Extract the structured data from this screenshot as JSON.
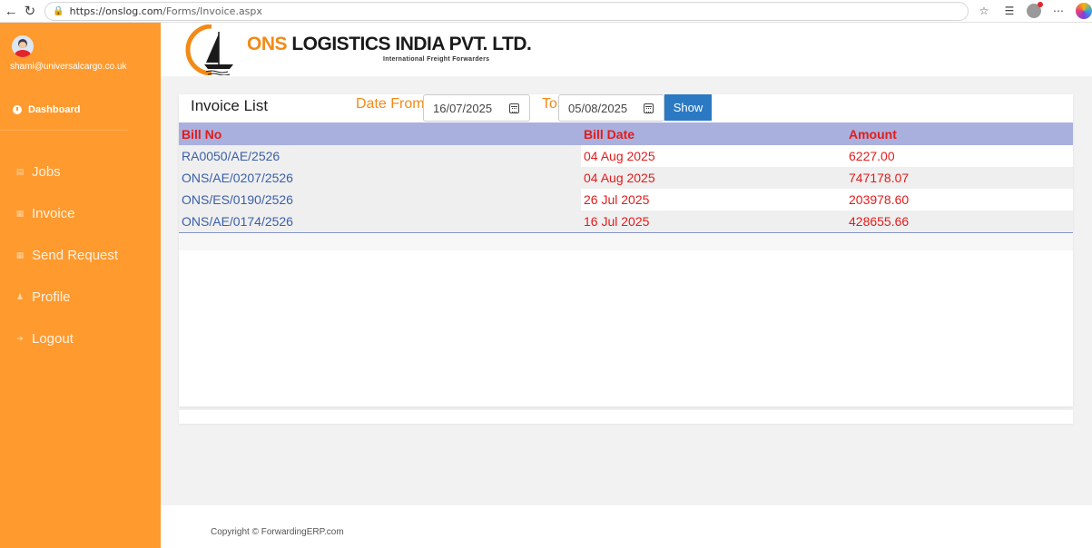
{
  "browser": {
    "url_host": "https://onslog.com",
    "url_path": "/Forms/Invoice.aspx"
  },
  "sidebar": {
    "user_email": "shami@universalcargo.co.uk",
    "dashboard_label": "Dashboard",
    "items": [
      {
        "label": "Jobs",
        "icon": "chart-icon"
      },
      {
        "label": "Invoice",
        "icon": "table-icon"
      },
      {
        "label": "Send Request",
        "icon": "table-icon"
      },
      {
        "label": "Profile",
        "icon": "user-icon"
      },
      {
        "label": "Logout",
        "icon": "logout-icon"
      }
    ]
  },
  "header": {
    "brand_ons": "ONS",
    "brand_rest": " LOGISTICS INDIA PVT. LTD.",
    "tagline": "International Freight Forwarders"
  },
  "invoice": {
    "title": "Invoice List",
    "date_from_label": "Date From",
    "date_from_value": "16/07/2025",
    "to_label": "To",
    "date_to_value": "05/08/2025",
    "show_label": "Show",
    "columns": {
      "bill_no": "Bill No",
      "bill_date": "Bill Date",
      "amount": "Amount"
    },
    "rows": [
      {
        "bill_no": "RA0050/AE/2526",
        "bill_date": "04 Aug 2025",
        "amount": "6227.00"
      },
      {
        "bill_no": "ONS/AE/0207/2526",
        "bill_date": "04 Aug 2025",
        "amount": "747178.07"
      },
      {
        "bill_no": "ONS/ES/0190/2526",
        "bill_date": "26 Jul 2025",
        "amount": "203978.60"
      },
      {
        "bill_no": "ONS/AE/0174/2526",
        "bill_date": "16 Jul 2025",
        "amount": "428655.66"
      }
    ]
  },
  "footer": {
    "copyright": "Copyright © ForwardingERP.com"
  },
  "colors": {
    "sidebar": "#ff9a2e",
    "accent_orange": "#f28a17",
    "header_row": "#aab0de",
    "red_text": "#e31b1b",
    "link_blue": "#3a5fa8",
    "button_blue": "#2b79c2"
  }
}
